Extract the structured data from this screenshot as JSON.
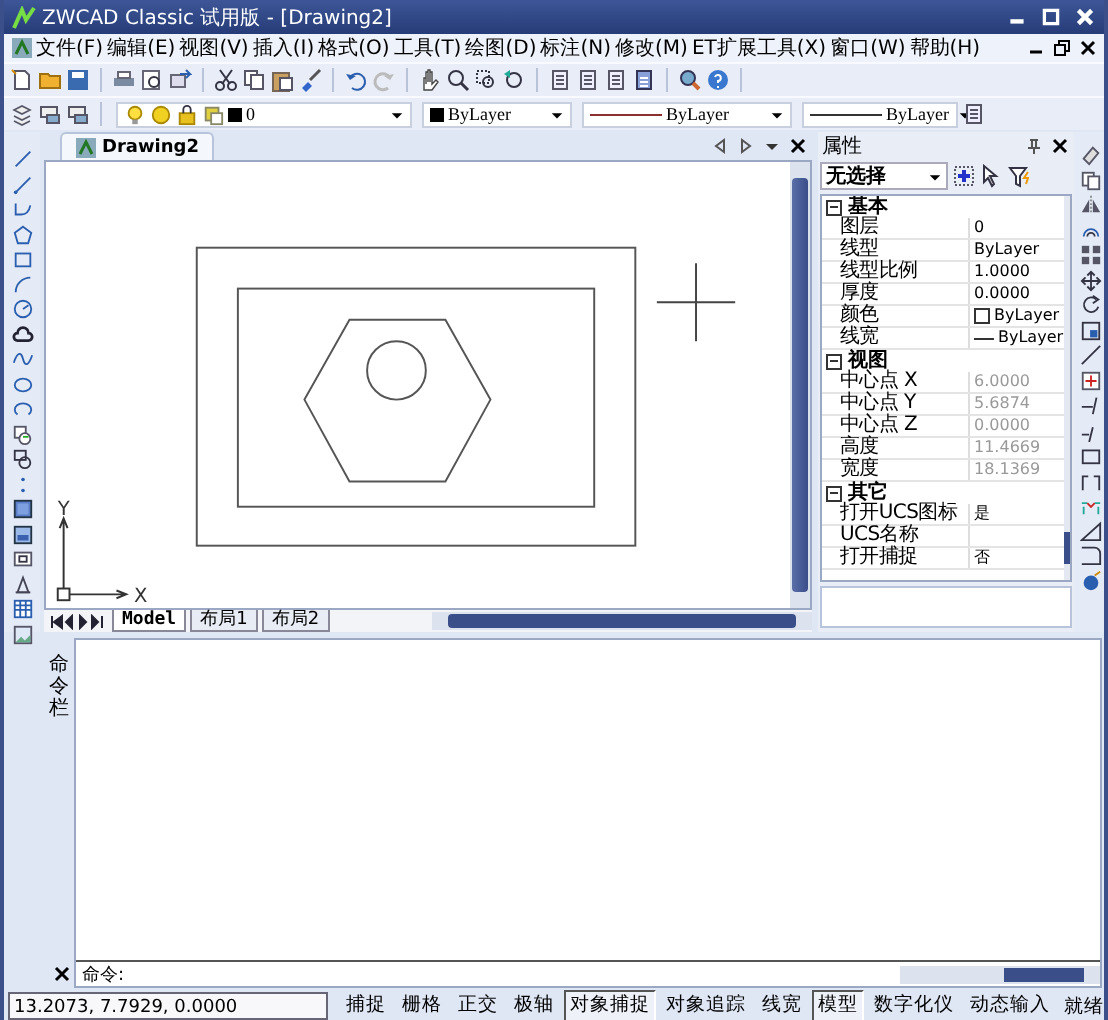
{
  "window": {
    "title": "ZWCAD Classic 试用版 - [Drawing2]"
  },
  "menu": [
    "文件(F)",
    "编辑(E)",
    "视图(V)",
    "插入(I)",
    "格式(O)",
    "工具(T)",
    "绘图(D)",
    "标注(N)",
    "修改(M)",
    "ET扩展工具(X)",
    "窗口(W)",
    "帮助(H)"
  ],
  "layer_toolbar": {
    "layer": "0",
    "color_setting": "ByLayer",
    "linetype": "ByLayer",
    "lineweight": "ByLayer"
  },
  "drawing_tab": {
    "title": "Drawing2"
  },
  "layout_tabs": [
    {
      "label": "Model",
      "selected": true
    },
    {
      "label": "布局1",
      "selected": false
    },
    {
      "label": "布局2",
      "selected": false
    }
  ],
  "ucs": {
    "x_label": "X",
    "y_label": "Y"
  },
  "properties": {
    "title": "属性",
    "selection": "无选择",
    "sections": [
      {
        "name": "基本",
        "expanded": true,
        "rows": [
          {
            "name": "图层",
            "value": "0",
            "kind": "text",
            "disabled": false
          },
          {
            "name": "线型",
            "value": "ByLayer",
            "kind": "text",
            "disabled": false
          },
          {
            "name": "线型比例",
            "value": "1.0000",
            "kind": "text",
            "disabled": false
          },
          {
            "name": "厚度",
            "value": "0.0000",
            "kind": "text",
            "disabled": false
          },
          {
            "name": "颜色",
            "value": "ByLayer",
            "kind": "color",
            "disabled": false
          },
          {
            "name": "线宽",
            "value": "ByLayer",
            "kind": "lineweight",
            "disabled": false
          }
        ]
      },
      {
        "name": "视图",
        "expanded": true,
        "rows": [
          {
            "name": "中心点 X",
            "value": "6.0000",
            "kind": "text",
            "disabled": true
          },
          {
            "name": "中心点 Y",
            "value": "5.6874",
            "kind": "text",
            "disabled": true
          },
          {
            "name": "中心点 Z",
            "value": "0.0000",
            "kind": "text",
            "disabled": true
          },
          {
            "name": "高度",
            "value": "11.4669",
            "kind": "text",
            "disabled": true
          },
          {
            "name": "宽度",
            "value": "18.1369",
            "kind": "text",
            "disabled": true
          }
        ]
      },
      {
        "name": "其它",
        "expanded": true,
        "rows": [
          {
            "name": "打开UCS图标",
            "value": "是",
            "kind": "text",
            "disabled": false
          },
          {
            "name": "UCS名称",
            "value": "",
            "kind": "text",
            "disabled": false
          },
          {
            "name": "打开捕捉",
            "value": "否",
            "kind": "text",
            "disabled": false
          }
        ]
      }
    ]
  },
  "command": {
    "side_label": "命令栏",
    "prompt": "命令:"
  },
  "status_bar": {
    "coordinates": "13.2073,  7.7929,  0.0000",
    "toggles": [
      {
        "label": "捕捉",
        "on": false
      },
      {
        "label": "栅格",
        "on": false
      },
      {
        "label": "正交",
        "on": false
      },
      {
        "label": "极轴",
        "on": false
      },
      {
        "label": "对象捕捉",
        "on": true
      },
      {
        "label": "对象追踪",
        "on": false
      },
      {
        "label": "线宽",
        "on": false
      },
      {
        "label": "模型",
        "on": true
      },
      {
        "label": "数字化仪",
        "on": false
      },
      {
        "label": "动态输入",
        "on": false
      }
    ],
    "state": "就绪"
  }
}
